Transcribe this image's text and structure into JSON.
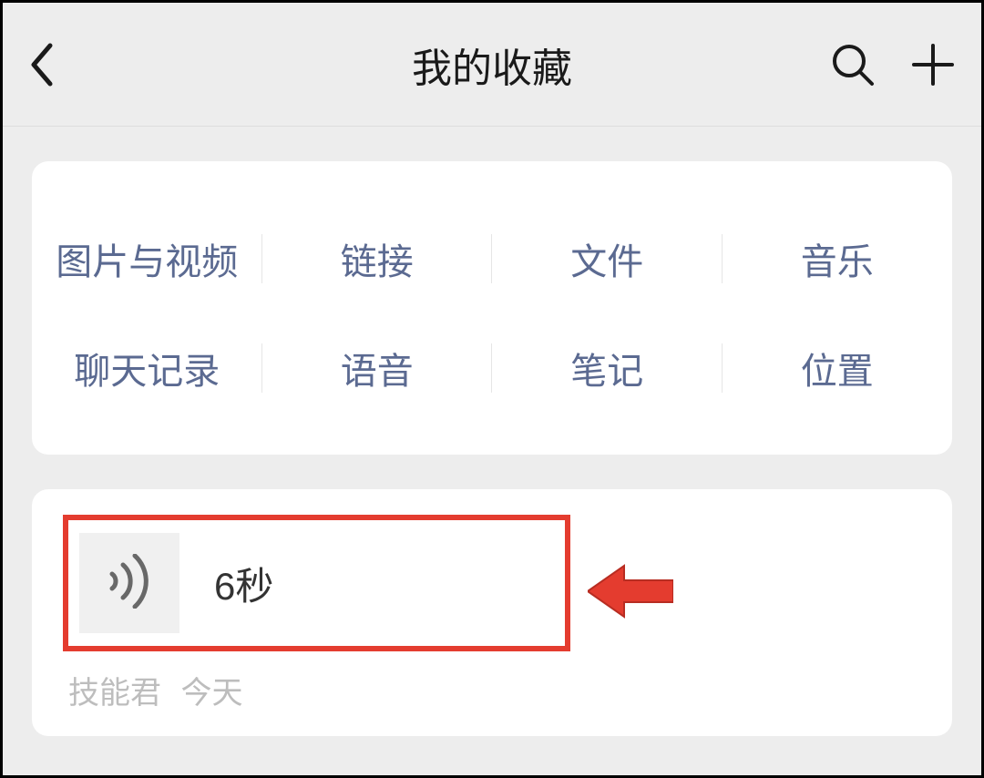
{
  "header": {
    "title": "我的收藏"
  },
  "categories": {
    "row1": [
      {
        "label": "图片与视频"
      },
      {
        "label": "链接"
      },
      {
        "label": "文件"
      },
      {
        "label": "音乐"
      }
    ],
    "row2": [
      {
        "label": "聊天记录"
      },
      {
        "label": "语音"
      },
      {
        "label": "笔记"
      },
      {
        "label": "位置"
      }
    ]
  },
  "favorite_item": {
    "duration_text": "6秒",
    "source": "技能君",
    "time": "今天"
  },
  "annotation": {
    "highlight_color": "#e43c2f"
  }
}
